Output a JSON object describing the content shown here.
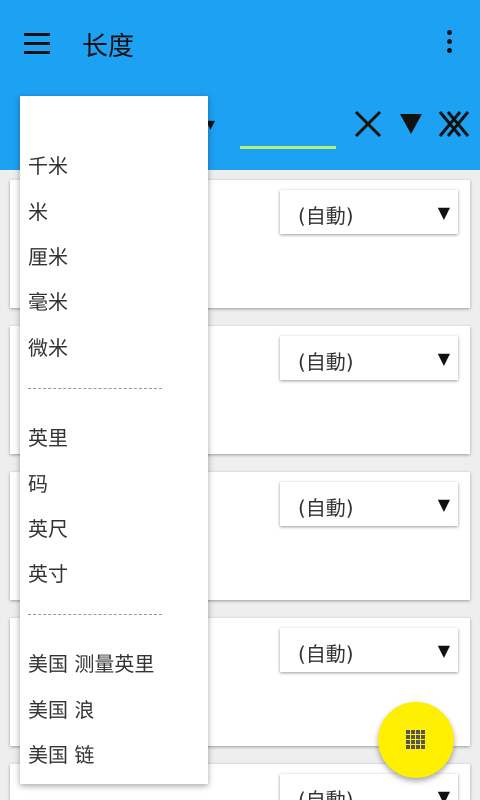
{
  "app_bar": {
    "title": "长度"
  },
  "cards": [
    {
      "select_value": "(自動)"
    },
    {
      "select_value": "(自動)"
    },
    {
      "select_value": "(自動)"
    },
    {
      "select_value": "(自動)"
    },
    {
      "select_value": "(自動)"
    }
  ],
  "dropdown": {
    "items": [
      {
        "label": "千米"
      },
      {
        "label": "米"
      },
      {
        "label": "厘米"
      },
      {
        "label": "毫米"
      },
      {
        "label": "微米"
      },
      {
        "label": "英里"
      },
      {
        "label": "码"
      },
      {
        "label": "英尺"
      },
      {
        "label": "英寸"
      },
      {
        "label": "美国 测量英里"
      },
      {
        "label": "美国 浪"
      },
      {
        "label": "美国 链"
      }
    ]
  },
  "colors": {
    "appbar": "#1da1f2",
    "fab": "#ffef00",
    "input_underline": "#b6f07a"
  },
  "icons": [
    "menu-icon",
    "more-vert-icon",
    "clear-icon",
    "arrow-down-icon",
    "clear-all-icon",
    "keypad-icon"
  ]
}
